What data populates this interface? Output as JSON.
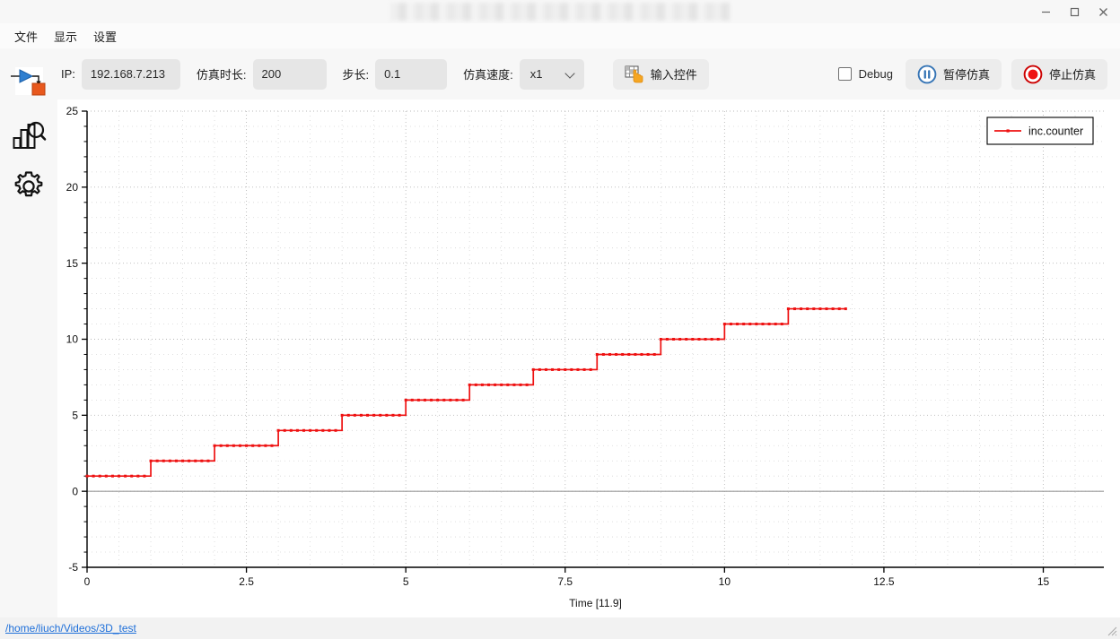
{
  "window": {
    "title_redacted": true,
    "controls": [
      {
        "name": "minimize",
        "glyph": "—"
      },
      {
        "name": "maximize",
        "glyph": "□"
      },
      {
        "name": "close",
        "glyph": "✕"
      }
    ]
  },
  "menubar": {
    "items": [
      {
        "label": "文件",
        "name": "menu-file"
      },
      {
        "label": "显示",
        "name": "menu-view"
      },
      {
        "label": "设置",
        "name": "menu-settings"
      }
    ]
  },
  "toolbar": {
    "ip_label": "IP:",
    "ip_value": "192.168.7.213",
    "duration_label": "仿真时长:",
    "duration_value": "200",
    "step_label": "步长:",
    "step_value": "0.1",
    "speed_label": "仿真速度:",
    "speed_value": "x1",
    "input_widget_label": "输入控件",
    "debug_label": "Debug",
    "debug_checked": false,
    "pause_label": "暂停仿真",
    "stop_label": "停止仿真"
  },
  "sidebar": {
    "items": [
      {
        "name": "model-run-icon",
        "label": "model"
      },
      {
        "name": "chart-inspect-icon",
        "label": "analysis"
      },
      {
        "name": "gear-icon",
        "label": "settings"
      }
    ]
  },
  "statusbar": {
    "path": "/home/liuch/Videos/3D_test"
  },
  "colors": {
    "series": "#ee1111",
    "pause_accent": "#3574b5",
    "stop_accent": "#cc0000",
    "link": "#1e6fd9",
    "grid": "#c8c8c8"
  },
  "chart_data": {
    "type": "line",
    "title": "",
    "xlabel": "Time [11.9]",
    "ylabel": "",
    "xlim": [
      0,
      15.95
    ],
    "ylim": [
      -5,
      25
    ],
    "xticks": [
      0,
      2.5,
      5,
      7.5,
      10,
      12.5,
      15
    ],
    "xticklabels": [
      "0",
      "2.5",
      "5",
      "7.5",
      "10",
      "12.5",
      "15"
    ],
    "yticks": [
      -5,
      0,
      5,
      10,
      15,
      20,
      25
    ],
    "yticklabels": [
      "-5",
      "0",
      "5",
      "10",
      "15",
      "20",
      "25"
    ],
    "grid": true,
    "grid_style": "dotted",
    "zero_line": true,
    "legend": {
      "position": "top-right",
      "entries": [
        {
          "name": "inc.counter",
          "color": "#ee1111",
          "marker": "square"
        }
      ]
    },
    "series": [
      {
        "name": "inc.counter",
        "color": "#ee1111",
        "drawstyle": "steps-post",
        "marker": "square",
        "x": [
          0,
          0.1,
          0.2,
          0.3,
          0.4,
          0.5,
          0.6,
          0.7,
          0.8,
          0.9,
          1.0,
          1.1,
          1.2,
          1.3,
          1.4,
          1.5,
          1.6,
          1.7,
          1.8,
          1.9,
          2.0,
          2.1,
          2.2,
          2.3,
          2.4,
          2.5,
          2.6,
          2.7,
          2.8,
          2.9,
          3.0,
          3.1,
          3.2,
          3.3,
          3.4,
          3.5,
          3.6,
          3.7,
          3.8,
          3.9,
          4.0,
          4.1,
          4.2,
          4.3,
          4.4,
          4.5,
          4.6,
          4.7,
          4.8,
          4.9,
          5.0,
          5.1,
          5.2,
          5.3,
          5.4,
          5.5,
          5.6,
          5.7,
          5.8,
          5.9,
          6.0,
          6.1,
          6.2,
          6.3,
          6.4,
          6.5,
          6.6,
          6.7,
          6.8,
          6.9,
          7.0,
          7.1,
          7.2,
          7.3,
          7.4,
          7.5,
          7.6,
          7.7,
          7.8,
          7.9,
          8.0,
          8.1,
          8.2,
          8.3,
          8.4,
          8.5,
          8.6,
          8.7,
          8.8,
          8.9,
          9.0,
          9.1,
          9.2,
          9.3,
          9.4,
          9.5,
          9.6,
          9.7,
          9.8,
          9.9,
          10.0,
          10.1,
          10.2,
          10.3,
          10.4,
          10.5,
          10.6,
          10.7,
          10.8,
          10.9,
          11.0,
          11.1,
          11.2,
          11.3,
          11.4,
          11.5,
          11.6,
          11.7,
          11.8,
          11.9
        ],
        "y": [
          1,
          1,
          1,
          1,
          1,
          1,
          1,
          1,
          1,
          1,
          2,
          2,
          2,
          2,
          2,
          2,
          2,
          2,
          2,
          2,
          3,
          3,
          3,
          3,
          3,
          3,
          3,
          3,
          3,
          3,
          4,
          4,
          4,
          4,
          4,
          4,
          4,
          4,
          4,
          4,
          5,
          5,
          5,
          5,
          5,
          5,
          5,
          5,
          5,
          5,
          6,
          6,
          6,
          6,
          6,
          6,
          6,
          6,
          6,
          6,
          7,
          7,
          7,
          7,
          7,
          7,
          7,
          7,
          7,
          7,
          8,
          8,
          8,
          8,
          8,
          8,
          8,
          8,
          8,
          8,
          9,
          9,
          9,
          9,
          9,
          9,
          9,
          9,
          9,
          9,
          10,
          10,
          10,
          10,
          10,
          10,
          10,
          10,
          10,
          10,
          11,
          11,
          11,
          11,
          11,
          11,
          11,
          11,
          11,
          11,
          12,
          12,
          12,
          12,
          12,
          12,
          12,
          12,
          12,
          12
        ]
      }
    ]
  }
}
